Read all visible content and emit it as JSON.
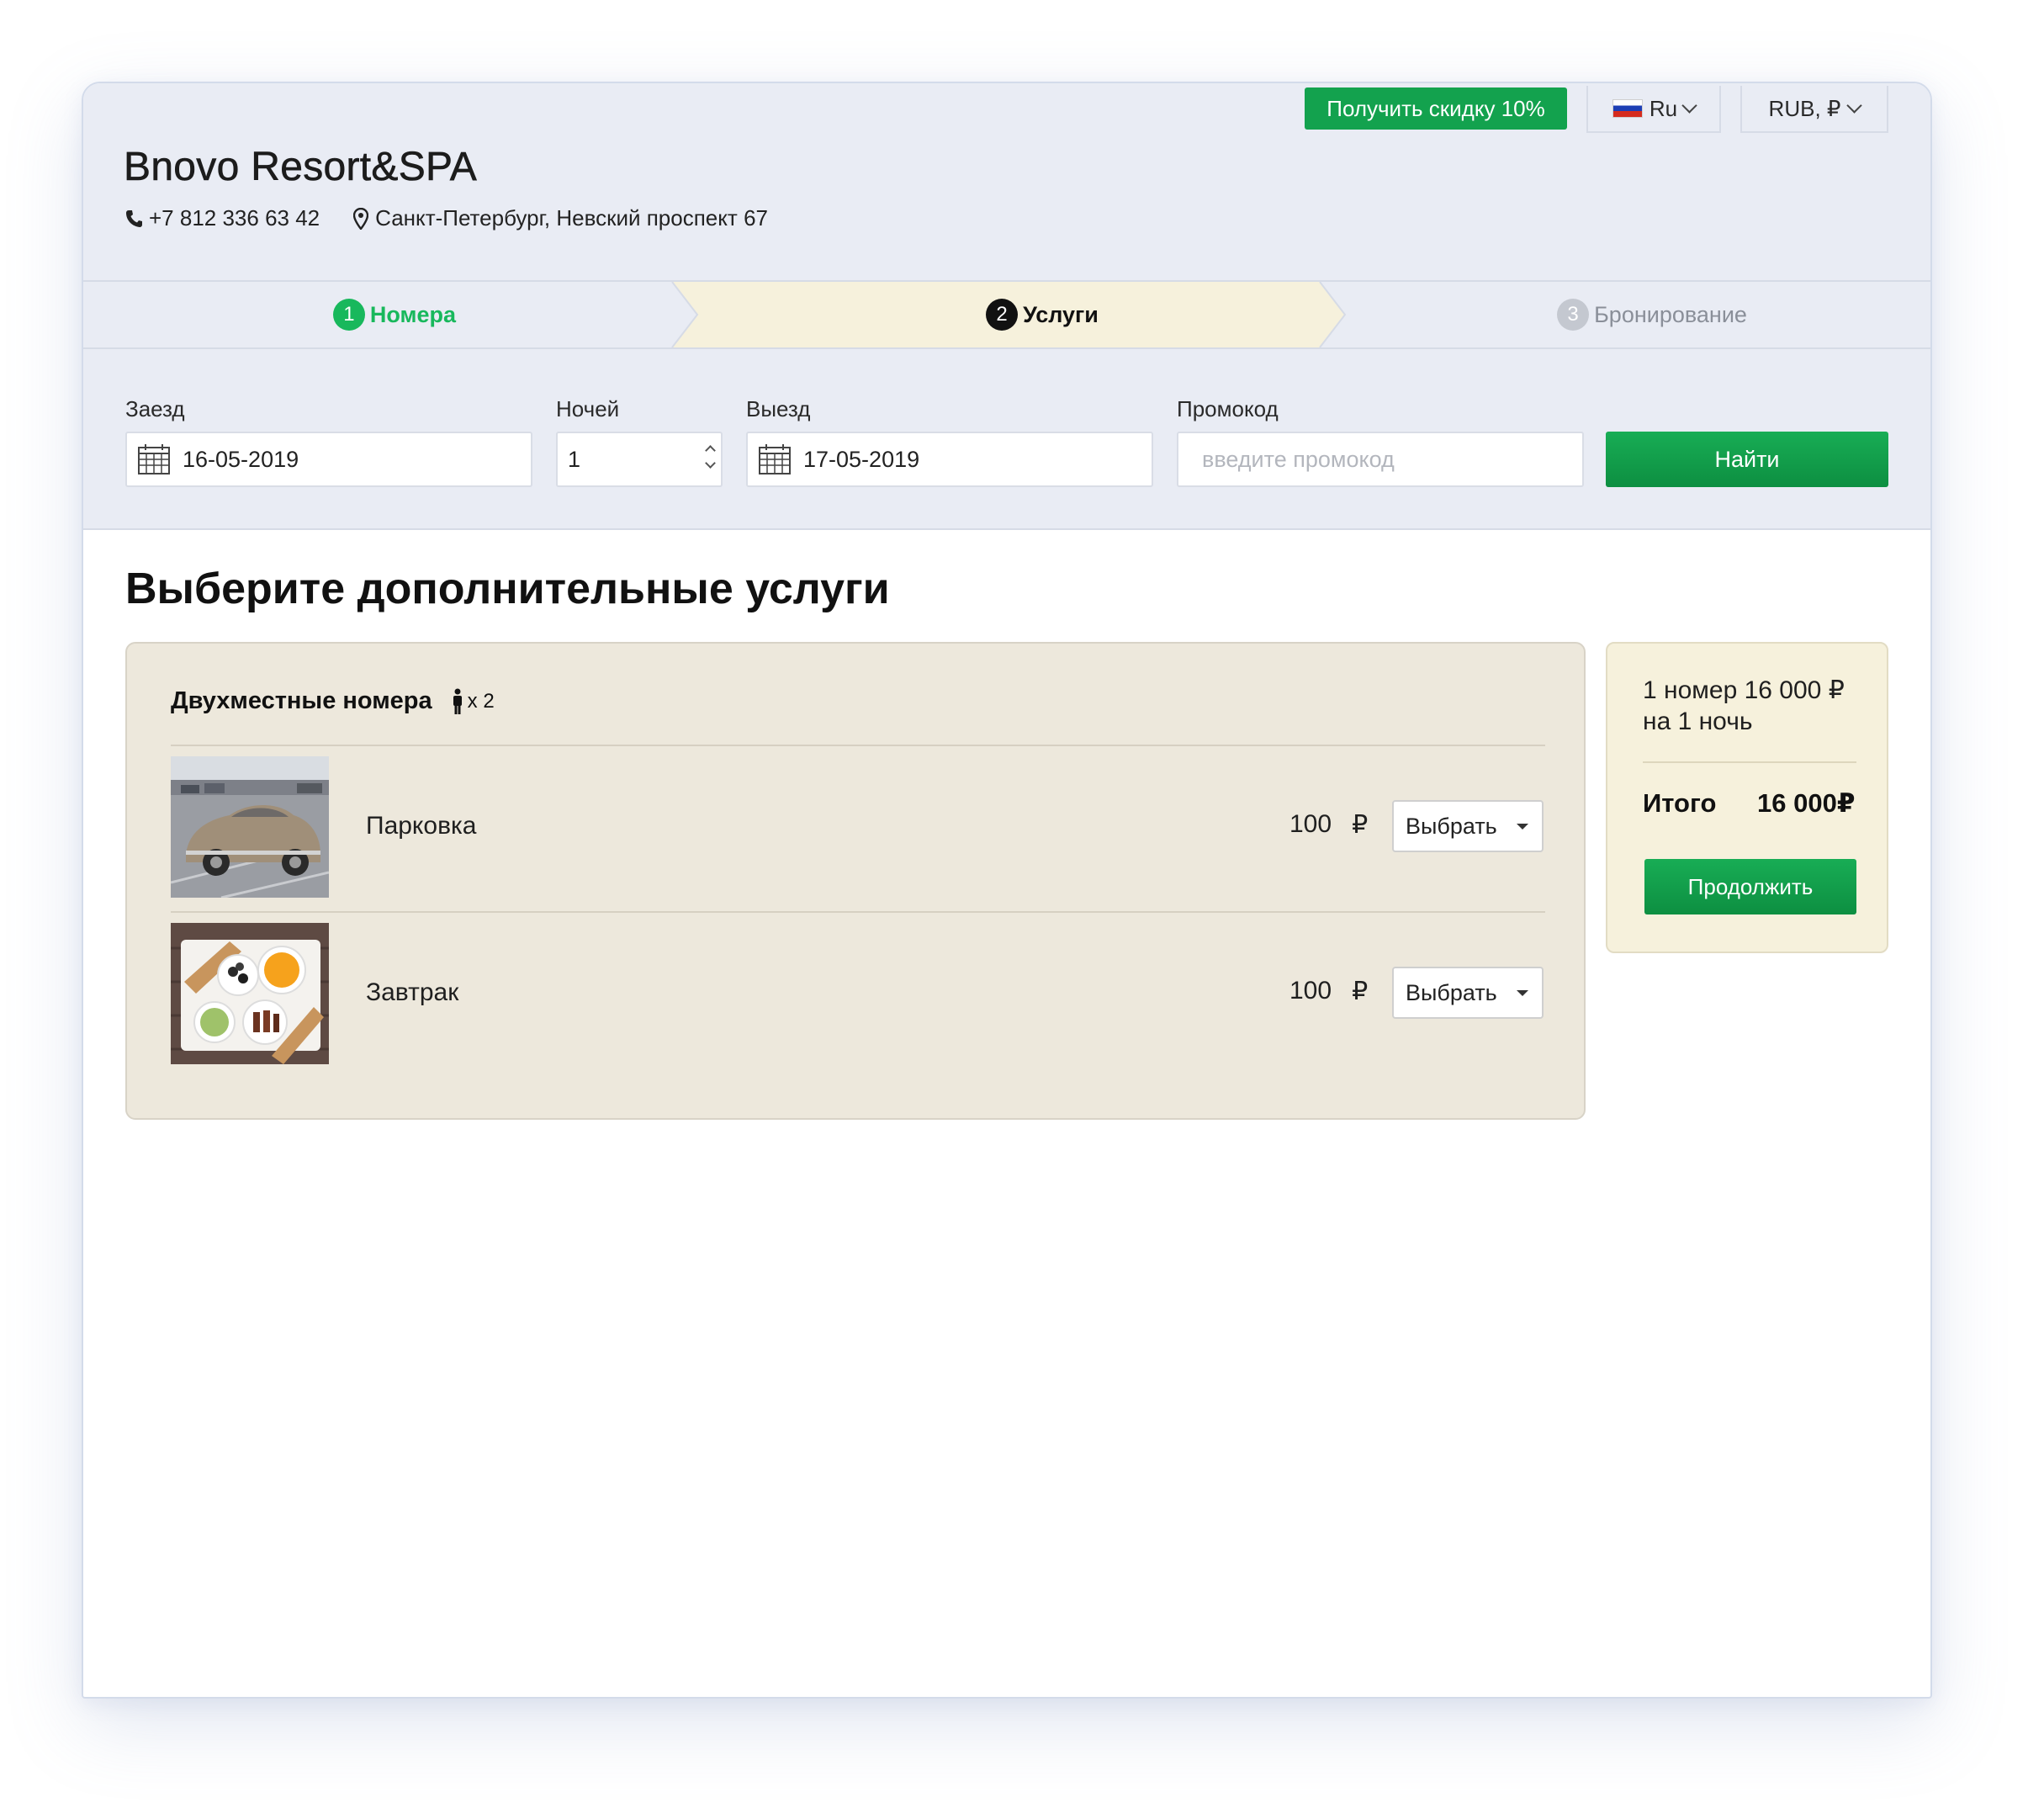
{
  "header": {
    "hotel_name": "Bnovo Resort&SPA",
    "phone": "+7 812 336 63 42",
    "address": "Санкт-Петербург, Невский проспект 67",
    "discount_button": "Получить скидку 10%",
    "language": "Ru",
    "currency": "RUB, ₽"
  },
  "steps": [
    {
      "number": "1",
      "label": "Номера",
      "state": "done"
    },
    {
      "number": "2",
      "label": "Услуги",
      "state": "active"
    },
    {
      "number": "3",
      "label": "Бронирование",
      "state": "pending"
    }
  ],
  "search": {
    "checkin_label": "Заезд",
    "checkin_value": "16-05-2019",
    "nights_label": "Ночей",
    "nights_value": "1",
    "checkout_label": "Выезд",
    "checkout_value": "17-05-2019",
    "promo_label": "Промокод",
    "promo_placeholder": "введите промокод",
    "find_button": "Найти"
  },
  "main": {
    "title": "Выберите дополнительные услуги",
    "room_title": "Двухместные номера",
    "guests": "x 2",
    "services": [
      {
        "name": "Парковка",
        "price": "100",
        "currency": "₽",
        "select_label": "Выбрать",
        "image": "car-photo"
      },
      {
        "name": "Завтрак",
        "price": "100",
        "currency": "₽",
        "select_label": "Выбрать",
        "image": "breakfast-photo"
      }
    ]
  },
  "summary": {
    "line1": "1 номер 16 000 ₽",
    "line2": "на 1 ночь",
    "total_label": "Итого",
    "total_value": "16 000₽",
    "continue_button": "Продолжить"
  },
  "colors": {
    "accent_green": "#13a24e",
    "header_bg": "#e9ecf4",
    "services_bg": "#ede8dc",
    "summary_bg": "#f6f1dc",
    "active_step_bg": "#f6f1dc"
  }
}
